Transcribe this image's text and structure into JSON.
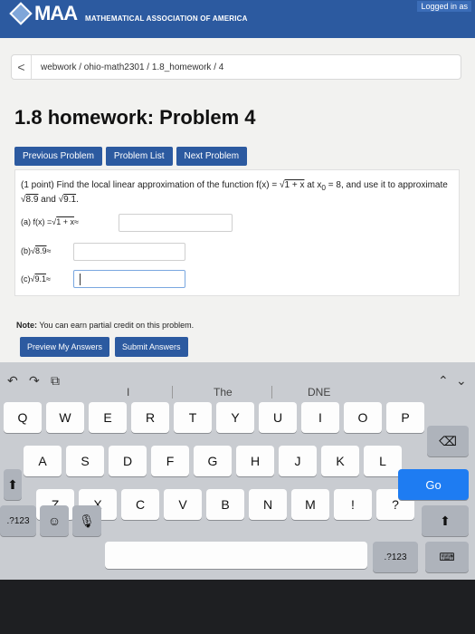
{
  "header": {
    "logo": "MAA",
    "org_name": "MATHEMATICAL ASSOCIATION OF AMERICA",
    "logged_in": "Logged in as"
  },
  "breadcrumb": {
    "back": "<",
    "path": "webwork / ohio-math2301 / 1.8_homework / 4"
  },
  "page_title": "1.8 homework: Problem 4",
  "nav": {
    "previous": "Previous Problem",
    "list": "Problem List",
    "next": "Next Problem"
  },
  "problem": {
    "intro_pre": "(1 point) Find the local linear approximation of the function f(x) = ",
    "func_sqrt": "1 + x",
    "intro_mid": " at x",
    "intro_sub": "0",
    "intro_post": " = 8, and use it to approximate ",
    "approx_a": "8.9",
    "and": " and ",
    "approx_b": "9.1",
    "end": ".",
    "part_a_label": "(a) f(x) = ",
    "part_a_sqrt": "1 + x",
    "approx_sym": " ≈",
    "part_b_label": "(b) ",
    "part_b_sqrt": "8.9",
    "part_c_label": "(c) ",
    "part_c_sqrt": "9.1"
  },
  "note": {
    "bold": "Note:",
    "text": " You can earn partial credit on this problem."
  },
  "submit": {
    "preview": "Preview My Answers",
    "submit": "Submit Answers"
  },
  "keyboard": {
    "suggestions": [
      "I",
      "The",
      "DNE"
    ],
    "row1": [
      "Q",
      "W",
      "E",
      "R",
      "T",
      "Y",
      "U",
      "I",
      "O",
      "P"
    ],
    "row2": [
      "A",
      "S",
      "D",
      "F",
      "G",
      "H",
      "J",
      "K",
      "L"
    ],
    "row3": [
      "Z",
      "X",
      "C",
      "V",
      "B",
      "N",
      "M",
      "!",
      "?"
    ],
    "go": "Go",
    "numbers_left": ".?123",
    "numbers_right": ".?123",
    "shift_icon": "shift-icon",
    "backspace_icon": "backspace-icon",
    "emoji_icon": "emoji-icon",
    "mic_icon": "microphone-icon",
    "hide_icon": "hide-keyboard-icon"
  },
  "colors": {
    "brand_blue": "#2c5aa0",
    "go_blue": "#1e7cf2"
  }
}
